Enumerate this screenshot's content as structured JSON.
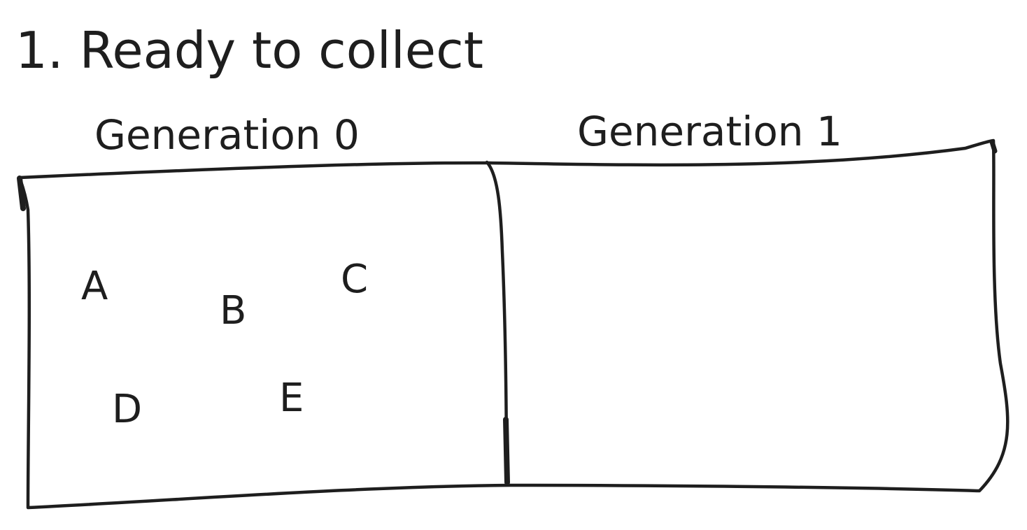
{
  "title": "1. Ready to collect",
  "generations": [
    {
      "label": "Generation 0",
      "objects": [
        "A",
        "B",
        "C",
        "D",
        "E"
      ]
    },
    {
      "label": "Generation 1",
      "objects": []
    }
  ]
}
